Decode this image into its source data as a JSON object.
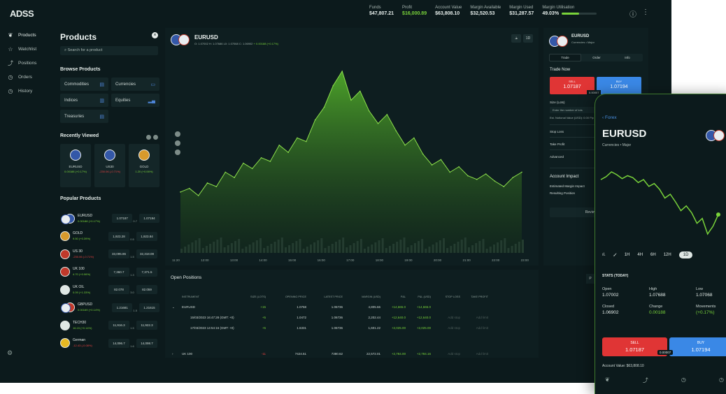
{
  "brand": "ADSS",
  "top": {
    "stats": [
      {
        "label": "Funds",
        "value": "$47,807.21",
        "green": false
      },
      {
        "label": "Profit",
        "value": "$16,000.89",
        "green": true
      },
      {
        "label": "Account Value",
        "value": "$63,808.10",
        "green": false
      },
      {
        "label": "Margin Available",
        "value": "$32,520.53",
        "green": false
      },
      {
        "label": "Margin Used",
        "value": "$31,287.57",
        "green": false
      }
    ],
    "margin_util": {
      "label": "Margin Utilisation",
      "value": "49.03%",
      "fraction": 0.49
    },
    "info_icon": "ⓘ",
    "menu_icon": "⋮"
  },
  "nav": [
    {
      "icon": "❦",
      "label": "Products"
    },
    {
      "icon": "☆",
      "label": "Watchlist"
    },
    {
      "icon": "⤴",
      "label": "Positions"
    },
    {
      "icon": "◷",
      "label": "Orders"
    },
    {
      "icon": "◷",
      "label": "History"
    }
  ],
  "nav_bottom_icon": "⚙",
  "products": {
    "title": "Products",
    "search_placeholder": "Search for a product",
    "browse_title": "Browse Products",
    "browse": [
      {
        "label": "Commodities",
        "icon": "▤"
      },
      {
        "label": "Currencies",
        "icon": "▭"
      },
      {
        "label": "Indices",
        "icon": "▥"
      },
      {
        "label": "Equities",
        "icon": "▂▄"
      },
      {
        "label": "Treasuries",
        "icon": "▤"
      }
    ],
    "recent_title": "Recently Viewed",
    "recent": [
      {
        "name": "EURUSD",
        "change": "0.00188 (+0.17%)",
        "color": "#79d33a"
      },
      {
        "name": "US30",
        "change": "-230.06 (-0.71%)",
        "color": "#e84040"
      },
      {
        "name": "GOLD",
        "change": "1.20 (+0.06%)",
        "color": "#79d33a"
      }
    ],
    "popular_title": "Popular Products",
    "popular": [
      {
        "name": "EURUSD",
        "change": "0.00188 (+0.17%)",
        "color": "#79d33a",
        "sell": "1.07187",
        "mid": "0.7",
        "buy": "1.07194",
        "flag": "#3357a8"
      },
      {
        "name": "GOLD",
        "change": "9.50 (+0.39%)",
        "color": "#79d33a",
        "sell": "1,923.28",
        "mid": "0.5",
        "buy": "1,923.84",
        "flag": "#d89a2c"
      },
      {
        "name": "US 30",
        "change": "-230.06 (-0.71%)",
        "color": "#e84040",
        "sell": "33,095.86",
        "mid": "1.5",
        "buy": "32,318.08",
        "flag": "#c0392b"
      },
      {
        "name": "UK 100",
        "change": "4.70 (+0.06%)",
        "color": "#79d33a",
        "sell": "7,360.7",
        "mid": "1.3",
        "buy": "7,371.5",
        "flag": "#c0392b"
      },
      {
        "name": "UK OIL",
        "change": "0.09 (+1.33%)",
        "color": "#79d33a",
        "sell": "82.078",
        "mid": "3.0",
        "buy": "82.059",
        "flag": "#dfe7e4"
      },
      {
        "name": "GBPUSD",
        "change": "0.00169 (+0.14%)",
        "color": "#79d33a",
        "sell": "1.21681",
        "mid": "1.5",
        "buy": "1.21615",
        "flag": "#c0392b"
      },
      {
        "name": "TECH30",
        "change": "16.15 (+0.14%)",
        "color": "#79d33a",
        "sell": "11,916.3",
        "mid": "1.5",
        "buy": "11,922.3",
        "flag": "#dfe7e4"
      },
      {
        "name": "German",
        "change": "-12.43 (-0.08%)",
        "color": "#e84040",
        "sell": "14,096.7",
        "mid": "1.6",
        "buy": "14,098.7",
        "flag": "#e8b923"
      }
    ]
  },
  "chart": {
    "symbol": "EURUSD",
    "ohlc": "O: 1.07002  H: 1.07686  L0: 1.07068  C: 1.06902",
    "change": "+ 0.00188 (+0.17%)",
    "btns": [
      "⫡",
      "1D"
    ],
    "xticks": [
      "11:20",
      "12:00",
      "13:00",
      "14:00",
      "15:00",
      "16:00",
      "17:00",
      "18:00",
      "19:00",
      "20:00",
      "21:00",
      "22:00",
      "23:00"
    ]
  },
  "chart_data": {
    "type": "area",
    "series": [
      {
        "values": [
          1.0701,
          1.0703,
          1.0699,
          1.0706,
          1.0704,
          1.0712,
          1.0709,
          1.0717,
          1.0714,
          1.072,
          1.0718,
          1.0727,
          1.0723,
          1.0731,
          1.0729,
          1.0741,
          1.0748,
          1.076,
          1.0768,
          1.0752,
          1.0757,
          1.0746,
          1.0739,
          1.0744,
          1.0735,
          1.0727,
          1.0731,
          1.0722,
          1.0716,
          1.0719,
          1.0712,
          1.0715,
          1.071,
          1.0708,
          1.0711,
          1.0707,
          1.0704,
          1.0709,
          1.0712
        ]
      }
    ],
    "grid": false
  },
  "positions": {
    "title": "Open Positions",
    "headers": [
      "",
      "INSTRUMENT",
      "SIZE (LOTS)",
      "OPENING PRICE",
      "LATEST PRICE",
      "MARGIN (USD)",
      "P&L",
      "P&L (USD)",
      "STOP LOSS",
      "TAKE PROFIT"
    ],
    "rows": [
      {
        "exp": "⌄",
        "inst": "EURUSD",
        "size": "+15",
        "open": "1.0758",
        "last": "1.06736",
        "margin": "4,805.66",
        "pnl": "+14,665.0",
        "pnlusd": "+14,665.0",
        "sl": "",
        "tp": "",
        "psign": "g"
      },
      {
        "exp": "",
        "inst": "15/03/2023 16:47:28 (GMT: +0)",
        "size": "+5",
        "open": "1.0472",
        "last": "1.06736",
        "margin": "2,202.44",
        "pnl": "+12,640.0",
        "pnlusd": "+12,640.0",
        "sl": "Add stop",
        "tp": "Add limit",
        "psign": "g"
      },
      {
        "exp": "",
        "inst": "17/03/2023 14:54:16 (GMT: +0)",
        "size": "+5",
        "open": "1.6331",
        "last": "1.06736",
        "margin": "1,601.22",
        "pnl": "+2,025.00",
        "pnlusd": "+2,025.00",
        "sl": "Add stop",
        "tp": "Add limit",
        "psign": "g"
      },
      {
        "exp": "›",
        "inst": "UK 100",
        "size": "-11",
        "open": "7424.51",
        "last": "7380.62",
        "margin": "22,572.01",
        "pnl": "+2,784.00",
        "pnlusd": "+2,784.16",
        "sl": "Add stop",
        "tp": "Add limit",
        "psign": "r"
      }
    ]
  },
  "trade": {
    "symbol": "EURUSD",
    "sub": "Currencies • Major",
    "tabs": [
      "Trade",
      "Order",
      "Info"
    ],
    "now": "Trade Now",
    "sell_label": "SELL",
    "sell": "1.07187",
    "buy_label": "BUY",
    "buy": "1.07194",
    "spread": "0.00007",
    "size_label": "Size (Lots)",
    "size_placeholder": "Enter the number of lots",
    "notional": "Est. Notional Value (USD): 0.00  Pip Value:",
    "sl": "Stop Loss",
    "tp": "Take Profit",
    "adv": "Advanced",
    "impact_title": "Account Impact",
    "impact_row": "Estimated   Margin   Impact",
    "result": "Resulting Position",
    "review": "Review Trade"
  },
  "mobile": {
    "back": "‹  Forex",
    "symbol": "EURUSD",
    "sub": "Currencies  •  Major",
    "timeframes": [
      "1H",
      "4H",
      "6H",
      "12H",
      "1D"
    ],
    "tf_icons": [
      "ıl.",
      "✓̸"
    ],
    "stats_title": "STATS (TODAY)",
    "stats": [
      {
        "k": "Open",
        "v": "1.07002",
        "g": false
      },
      {
        "k": "High",
        "v": "1.07688",
        "g": false
      },
      {
        "k": "Low",
        "v": "1.07068",
        "g": false
      },
      {
        "k": "Closed",
        "v": "1.06902",
        "g": false
      },
      {
        "k": "Change",
        "v": "0.00188",
        "g": true
      },
      {
        "k": "Movements",
        "v": "(+0.17%)",
        "g": true
      }
    ],
    "sell_label": "SELL",
    "sell": "1.07187",
    "buy_label": "BUY",
    "buy": "1.07194",
    "spread": "0.00007",
    "account": "Account Value:   $63,808.10",
    "navicons": [
      "❦",
      "⤴",
      "◷",
      "◷"
    ]
  }
}
